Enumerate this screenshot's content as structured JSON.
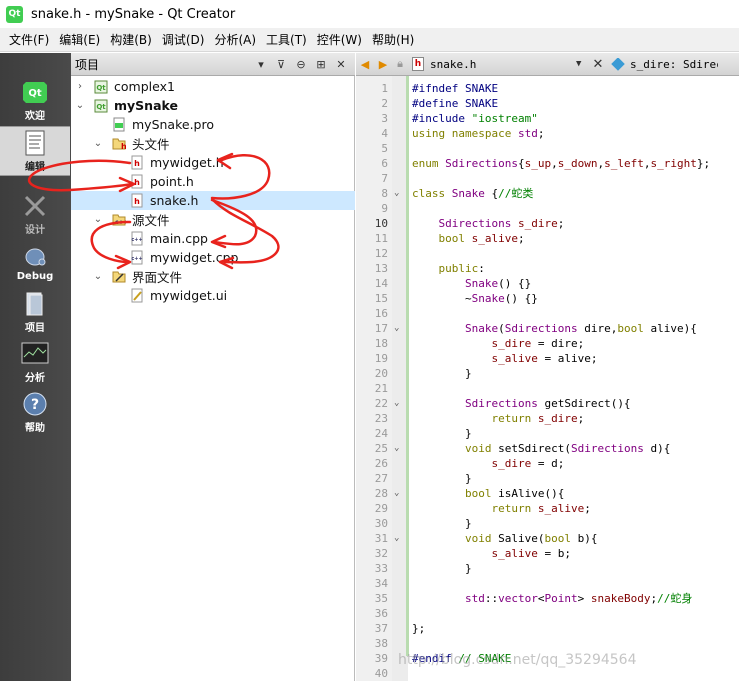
{
  "window": {
    "title": "snake.h - mySnake - Qt Creator",
    "app_icon": "qt-logo-icon",
    "app_icon_text": "Qt"
  },
  "menu": [
    "文件(F)",
    "编辑(E)",
    "构建(B)",
    "调试(D)",
    "分析(A)",
    "工具(T)",
    "控件(W)",
    "帮助(H)"
  ],
  "modes": [
    {
      "label": "欢迎",
      "icon": "qt-welcome-icon"
    },
    {
      "label": "编辑",
      "icon": "edit-document-icon",
      "active": true
    },
    {
      "label": "设计",
      "icon": "design-icon"
    },
    {
      "label": "Debug",
      "icon": "debug-bug-icon"
    },
    {
      "label": "项目",
      "icon": "project-icon"
    },
    {
      "label": "分析",
      "icon": "analyze-icon"
    },
    {
      "label": "帮助",
      "icon": "help-icon"
    }
  ],
  "project_pane": {
    "title": "项目",
    "tree": [
      {
        "label": "complex1",
        "icon": "qt-project-icon",
        "level": 0,
        "arrow": "collapsed"
      },
      {
        "label": "mySnake",
        "icon": "qt-project-icon",
        "level": 0,
        "arrow": "expanded",
        "bold": true
      },
      {
        "label": "mySnake.pro",
        "icon": "pro-file-icon",
        "level": 1
      },
      {
        "label": "头文件",
        "icon": "header-folder-icon",
        "level": 1,
        "arrow": "expanded"
      },
      {
        "label": "mywidget.h",
        "icon": "header-file-icon",
        "level": 2
      },
      {
        "label": "point.h",
        "icon": "header-file-icon",
        "level": 2
      },
      {
        "label": "snake.h",
        "icon": "header-file-icon",
        "level": 2,
        "selected": true
      },
      {
        "label": "源文件",
        "icon": "source-folder-icon",
        "level": 1,
        "arrow": "expanded"
      },
      {
        "label": "main.cpp",
        "icon": "cpp-file-icon",
        "level": 2
      },
      {
        "label": "mywidget.cpp",
        "icon": "cpp-file-icon",
        "level": 2
      },
      {
        "label": "界面文件",
        "icon": "form-folder-icon",
        "level": 1,
        "arrow": "expanded"
      },
      {
        "label": "mywidget.ui",
        "icon": "ui-file-icon",
        "level": 2
      }
    ]
  },
  "editor_toolbar": {
    "file": "snake.h",
    "symbol": "s_dire: Sdirections"
  },
  "editor": {
    "current_line": 10,
    "lines": [
      {
        "n": 1,
        "text": "#ifndef SNAKE"
      },
      {
        "n": 2,
        "text": "#define SNAKE"
      },
      {
        "n": 3,
        "text": "#include \"iostream\""
      },
      {
        "n": 4,
        "text": "using namespace std;"
      },
      {
        "n": 5,
        "text": ""
      },
      {
        "n": 6,
        "text": "enum Sdirections{s_up,s_down,s_left,s_right};"
      },
      {
        "n": 7,
        "text": ""
      },
      {
        "n": 8,
        "text": "class Snake {//蛇类",
        "fold": true
      },
      {
        "n": 9,
        "text": ""
      },
      {
        "n": 10,
        "text": "    Sdirections s_dire;"
      },
      {
        "n": 11,
        "text": "    bool s_alive;"
      },
      {
        "n": 12,
        "text": ""
      },
      {
        "n": 13,
        "text": "    public:"
      },
      {
        "n": 14,
        "text": "        Snake() {}"
      },
      {
        "n": 15,
        "text": "        ~Snake() {}"
      },
      {
        "n": 16,
        "text": ""
      },
      {
        "n": 17,
        "text": "        Snake(Sdirections dire,bool alive){",
        "fold": true
      },
      {
        "n": 18,
        "text": "            s_dire = dire;"
      },
      {
        "n": 19,
        "text": "            s_alive = alive;"
      },
      {
        "n": 20,
        "text": "        }"
      },
      {
        "n": 21,
        "text": ""
      },
      {
        "n": 22,
        "text": "        Sdirections getSdirect(){",
        "fold": true
      },
      {
        "n": 23,
        "text": "            return s_dire;"
      },
      {
        "n": 24,
        "text": "        }"
      },
      {
        "n": 25,
        "text": "        void setSdirect(Sdirections d){",
        "fold": true
      },
      {
        "n": 26,
        "text": "            s_dire = d;"
      },
      {
        "n": 27,
        "text": "        }"
      },
      {
        "n": 28,
        "text": "        bool isAlive(){",
        "fold": true
      },
      {
        "n": 29,
        "text": "            return s_alive;"
      },
      {
        "n": 30,
        "text": "        }"
      },
      {
        "n": 31,
        "text": "        void Salive(bool b){",
        "fold": true
      },
      {
        "n": 32,
        "text": "            s_alive = b;"
      },
      {
        "n": 33,
        "text": "        }"
      },
      {
        "n": 34,
        "text": ""
      },
      {
        "n": 35,
        "text": "        std::vector<Point> snakeBody;//蛇身"
      },
      {
        "n": 36,
        "text": ""
      },
      {
        "n": 37,
        "text": "};"
      },
      {
        "n": 38,
        "text": ""
      },
      {
        "n": 39,
        "text": "#endif // SNAKE"
      },
      {
        "n": 40,
        "text": ""
      }
    ]
  },
  "watermark": "http://blog.csdn.net/qq_35294564",
  "colors": {
    "annotation": "#e8231d",
    "keyword": "#808000",
    "type": "#800080",
    "member": "#800000",
    "string": "#008000"
  }
}
